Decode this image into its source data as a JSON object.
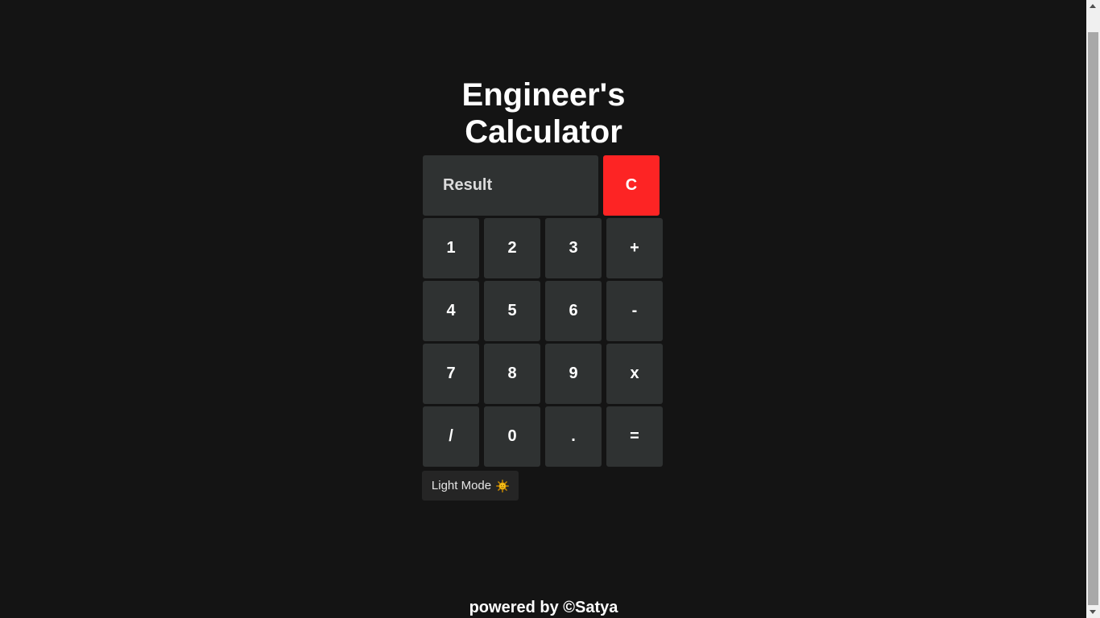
{
  "title_line1": "Engineer's",
  "title_line2": "Calculator",
  "display": {
    "value": "Result"
  },
  "clear_label": "C",
  "keys": [
    [
      "1",
      "2",
      "3",
      "+"
    ],
    [
      "4",
      "5",
      "6",
      "-"
    ],
    [
      "7",
      "8",
      "9",
      "x"
    ],
    [
      "/",
      "0",
      ".",
      "="
    ]
  ],
  "mode_toggle": {
    "label": "Light Mode",
    "icon": "sun-icon"
  },
  "footer": "powered by ©Satya",
  "colors": {
    "background": "#141414",
    "key": "#2f3232",
    "clear": "#fd2424",
    "text": "#ffffff"
  }
}
